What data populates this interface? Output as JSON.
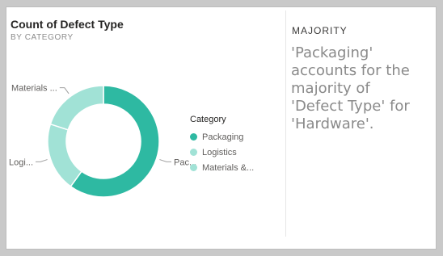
{
  "chart_data": {
    "type": "pie",
    "title": "Count of Defect Type",
    "subtitle": "BY CATEGORY",
    "legend_title": "Category",
    "legend_position": "right",
    "series": [
      {
        "name": "Packaging",
        "short_label": "Pac...",
        "value": 60,
        "color": "#2eb9a2"
      },
      {
        "name": "Logistics",
        "short_label": "Logi...",
        "value": 20,
        "color": "#a1e2d6"
      },
      {
        "name": "Materials & ...",
        "short_label": "Materials ...",
        "value": 20,
        "color": "#a1e2d6"
      }
    ],
    "legend_labels": [
      "Packaging",
      "Logistics",
      "Materials &..."
    ]
  },
  "insight": {
    "heading": "MAJORITY",
    "text": "'Packaging' accounts for the majority of 'Defect Type' for 'Hardware'."
  }
}
